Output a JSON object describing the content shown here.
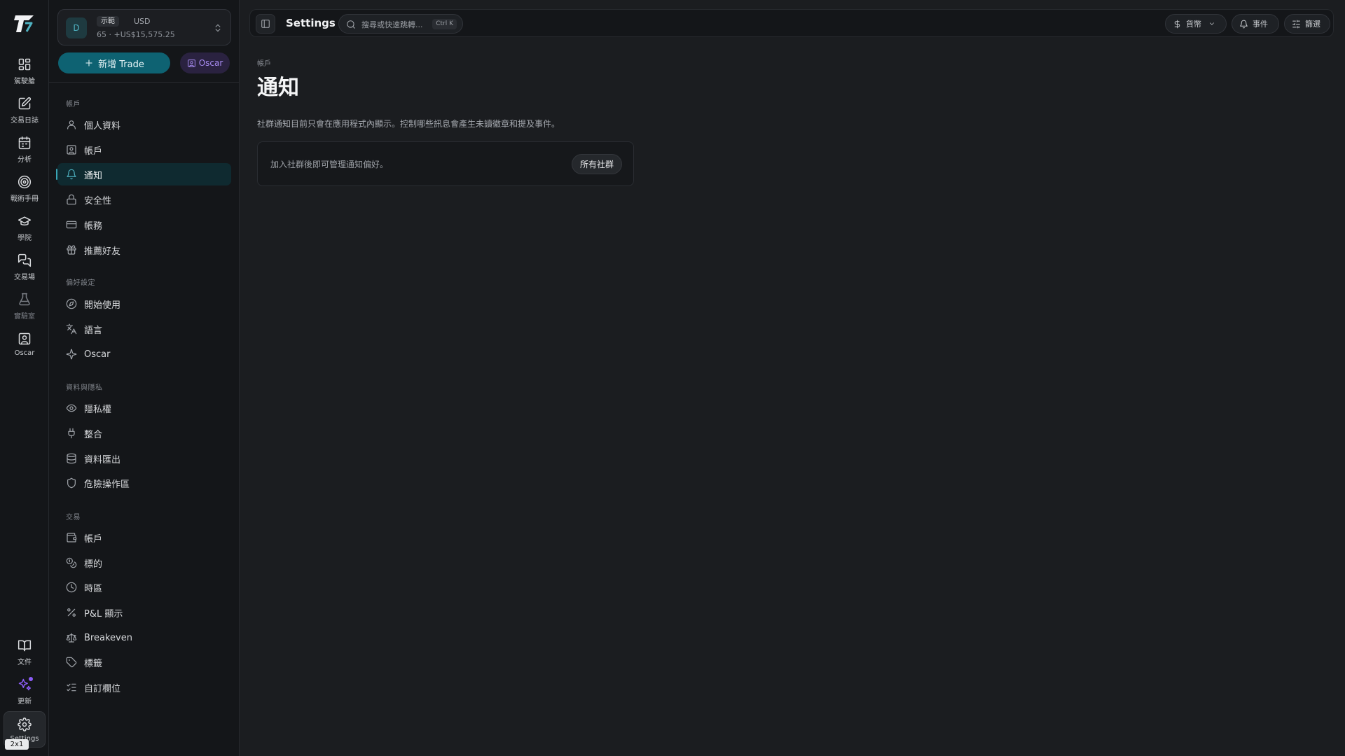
{
  "rail": {
    "items": [
      {
        "label": "駕駛艙",
        "icon": "dashboard-icon"
      },
      {
        "label": "交易日誌",
        "icon": "journal-edit-icon"
      },
      {
        "label": "分析",
        "icon": "calendar-icon"
      },
      {
        "label": "戰術手冊",
        "icon": "target-icon"
      },
      {
        "label": "學院",
        "icon": "graduation-cap-icon"
      },
      {
        "label": "交易場",
        "icon": "chat-icon"
      },
      {
        "label": "實驗室",
        "icon": "flask-icon"
      },
      {
        "label": "Oscar",
        "icon": "bot-icon"
      }
    ],
    "bottom": [
      {
        "label": "文件",
        "icon": "book-icon"
      },
      {
        "label": "更新",
        "icon": "sparkle-icon"
      },
      {
        "label": "Settings",
        "icon": "gear-icon"
      }
    ],
    "badge": "2x1"
  },
  "account": {
    "avatar": "D",
    "tag": "示範",
    "currency": "USD",
    "balance": "65 · +US$15,575.25"
  },
  "actions": {
    "new_trade": "新增 Trade",
    "oscar": "Oscar"
  },
  "sections": [
    {
      "title": "帳戶",
      "items": [
        {
          "label": "個人資料",
          "icon": "user-icon"
        },
        {
          "label": "帳戶",
          "icon": "id-card-icon"
        },
        {
          "label": "通知",
          "icon": "bell-icon",
          "active": true
        },
        {
          "label": "安全性",
          "icon": "lock-icon"
        },
        {
          "label": "帳務",
          "icon": "credit-card-icon"
        },
        {
          "label": "推薦好友",
          "icon": "gift-icon"
        }
      ]
    },
    {
      "title": "偏好設定",
      "items": [
        {
          "label": "開始使用",
          "icon": "compass-icon"
        },
        {
          "label": "語言",
          "icon": "translate-icon"
        },
        {
          "label": "Oscar",
          "icon": "sparkles-icon"
        }
      ]
    },
    {
      "title": "資料與隱私",
      "items": [
        {
          "label": "隱私權",
          "icon": "eye-icon"
        },
        {
          "label": "整合",
          "icon": "plug-icon"
        },
        {
          "label": "資料匯出",
          "icon": "database-icon"
        },
        {
          "label": "危險操作區",
          "icon": "shield-icon"
        }
      ]
    },
    {
      "title": "交易",
      "items": [
        {
          "label": "帳戶",
          "icon": "wallet-icon"
        },
        {
          "label": "標的",
          "icon": "coins-icon"
        },
        {
          "label": "時區",
          "icon": "clock-icon"
        },
        {
          "label": "P&L 顯示",
          "icon": "percent-icon"
        },
        {
          "label": "Breakeven",
          "icon": "scale-icon"
        },
        {
          "label": "標籤",
          "icon": "tag-icon"
        },
        {
          "label": "自訂欄位",
          "icon": "list-check-icon"
        }
      ]
    }
  ],
  "topbar": {
    "title": "Settings",
    "search_placeholder": "搜尋或快速跳轉...",
    "search_shortcut": "Ctrl K",
    "currency_label": "貨幣",
    "events_label": "事件",
    "filter_label": "篩選"
  },
  "main": {
    "breadcrumb": "帳戶",
    "title": "通知",
    "description": "社群通知目前只會在應用程式內顯示。控制哪些訊息會產生未讀徽章和提及事件。",
    "notice": "加入社群後即可管理通知偏好。",
    "all_communities": "所有社群"
  },
  "colors": {
    "accent": "#0e6272",
    "accent_text": "#4fb3c2",
    "oscar_purple": "#a88cf2",
    "background": "#1b1d20",
    "panel": "#141619"
  }
}
